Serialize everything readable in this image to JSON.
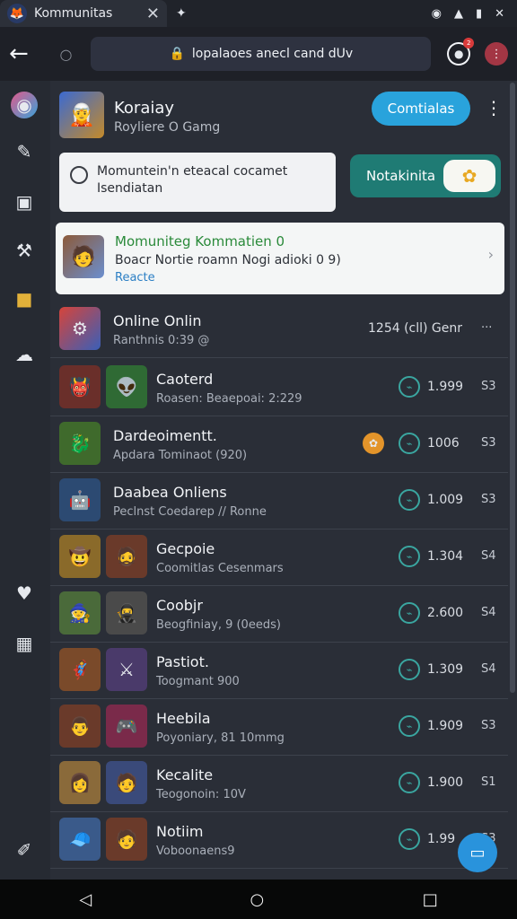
{
  "tabbar": {
    "tab_title": "Kommunitas",
    "new_tab_icon": "✦"
  },
  "urlbar": {
    "url": "lopalaoes anecl cand dUv"
  },
  "header": {
    "name": "Koraiay",
    "sub": "Royliere O Gamg",
    "action_label": "Comtialas",
    "badge": "2"
  },
  "input": {
    "text_line1": "Momuntein'n eteacal cocamet",
    "text_line2": "Isendiatan"
  },
  "notify": {
    "label": "Notakinita"
  },
  "highlight": {
    "title": "Momuniteg Kommatien 0",
    "subtitle": "Boacr Nortie roamn Nogi adioki 0 9)",
    "link": "Reacte"
  },
  "online": {
    "title": "Online Onlin",
    "sub": "Ranthnis 0:39 @",
    "value": "1254 (cll) Genr",
    "more": "···"
  },
  "rows": [
    {
      "name": "Caoterd",
      "sub": "Roasen: Beaepoai: 2:229",
      "value": "1.999",
      "rank": "S3"
    },
    {
      "name": "Dardeoimentt.",
      "sub": "Apdara Tominaot (920)",
      "value": "1006",
      "rank": "S3"
    },
    {
      "name": "Daabea Onliens",
      "sub": "Peclnst Coedarep // Ronne",
      "value": "1.009",
      "rank": "S3"
    },
    {
      "name": "Gecpoie",
      "sub": "Coomitlas Cesenmars",
      "value": "1.304",
      "rank": "S4"
    },
    {
      "name": "Coobjr",
      "sub": "Beogfiniay, 9 (0eeds)",
      "value": "2.600",
      "rank": "S4"
    },
    {
      "name": "Pastiot.",
      "sub": "Toogmant 900",
      "value": "1.309",
      "rank": "S4"
    },
    {
      "name": "Heebila",
      "sub": "Poyoniary, 81 10mmg",
      "value": "1.909",
      "rank": "S3"
    },
    {
      "name": "Kecalite",
      "sub": "Teogonoin: 10V",
      "value": "1.900",
      "rank": "S1"
    },
    {
      "name": "Notiim",
      "sub": "Voboonaens9",
      "value": "1.99",
      "rank": "S3"
    }
  ],
  "colors": {
    "accent": "#29a3dc",
    "teal": "#1f7b74",
    "panel": "#2a2e37"
  }
}
